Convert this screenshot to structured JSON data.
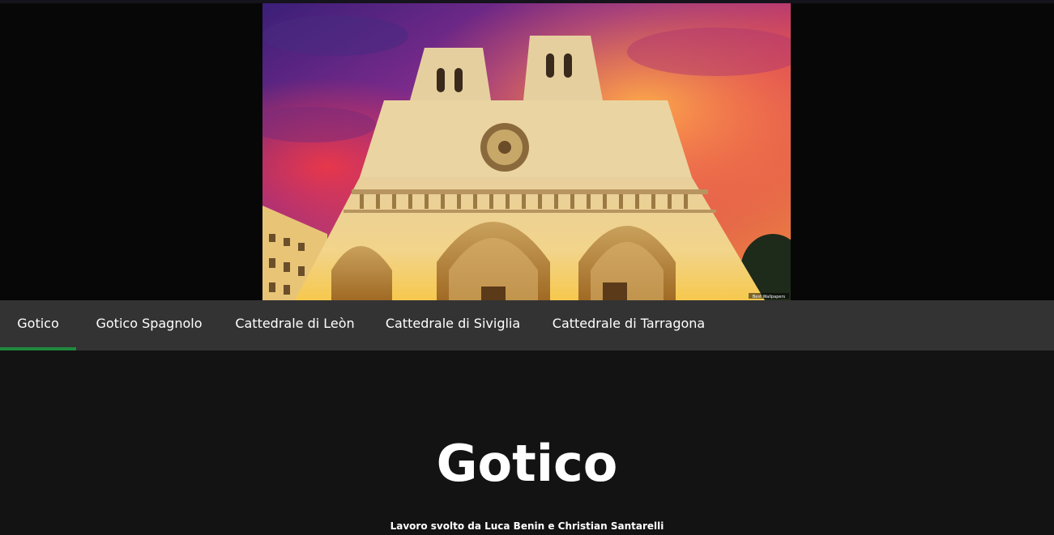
{
  "hero": {
    "image_alt": "Notre-Dame cathedral at sunset",
    "watermark": "Best Wallpapers"
  },
  "nav": {
    "items": [
      {
        "label": "Gotico",
        "active": true
      },
      {
        "label": "Gotico Spagnolo",
        "active": false
      },
      {
        "label": "Cattedrale di Leòn",
        "active": false
      },
      {
        "label": "Cattedrale di Siviglia",
        "active": false
      },
      {
        "label": "Cattedrale di Tarragona",
        "active": false
      }
    ]
  },
  "main": {
    "title": "Gotico",
    "credits": "Lavoro svolto da Luca Benin e Christian Santarelli"
  },
  "colors": {
    "background": "#131313",
    "hero_background": "#070707",
    "navbar": "#333333",
    "active_indicator": "#1f8a3c",
    "text": "#ffffff"
  }
}
